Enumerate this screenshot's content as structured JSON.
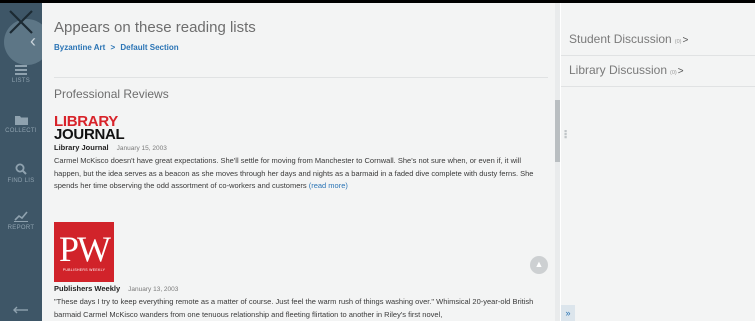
{
  "sidebar": {
    "items": [
      {
        "label": "LISTS",
        "icon": "list-icon"
      },
      {
        "label": "COLLECTI",
        "icon": "folder-icon"
      },
      {
        "label": "FIND LIS",
        "icon": "search-icon"
      },
      {
        "label": "REPORT",
        "icon": "chart-icon"
      }
    ]
  },
  "reading_lists": {
    "title": "Appears on these reading lists",
    "list_name": "Byzantine Art",
    "separator": ">",
    "section": "Default Section"
  },
  "reviews": {
    "title": "Professional Reviews",
    "items": [
      {
        "logo_line1": "LIBRARY",
        "logo_line2": "JOURNAL",
        "source": "Library Journal",
        "date": "January 15, 2003",
        "text": "Carmel McKisco doesn't have great expectations. She'll settle for moving from Manchester to Cornwall. She's not sure when, or even if, it will happen, but the idea serves as a beacon as she moves through her days and nights as a barmaid in a faded dive complete with dusty ferns. She spends her time observing the odd assortment of co-workers and customers",
        "more": "(read more)"
      },
      {
        "logo_text": "PW",
        "logo_sub": "PUBLISHERS WEEKLY",
        "source": "Publishers Weekly",
        "date": "January 13, 2003",
        "text": "\"These days I try to keep everything remote as a matter of course. Just feel the warm rush of things washing over.\" Whimsical 20-year-old British barmaid Carmel McKisco wanders from one tenuous relationship and fleeting flirtation to another in Riley's first novel,"
      }
    ]
  },
  "discussions": [
    {
      "label": "Student Discussion",
      "count": "(0)",
      "chevron": ">"
    },
    {
      "label": "Library Discussion",
      "count": "(0)",
      "chevron": ">"
    }
  ],
  "icons": {
    "close": "close-icon",
    "back": "chevron-left-icon",
    "scroll_top": "chevron-up-icon",
    "expand": "double-chevron-right-icon",
    "splitter": "drag-handle-icon",
    "exit": "arrow-left-icon"
  },
  "controls": {
    "expand_glyph": "»",
    "scroll_top_glyph": "▲",
    "back_glyph": "‹"
  },
  "colors": {
    "sidebar_bg": "#3e5667",
    "link": "#2a74b5",
    "lj_red": "#d8232a",
    "pw_red": "#d1232a",
    "panel_bg": "#f3f4f4"
  }
}
